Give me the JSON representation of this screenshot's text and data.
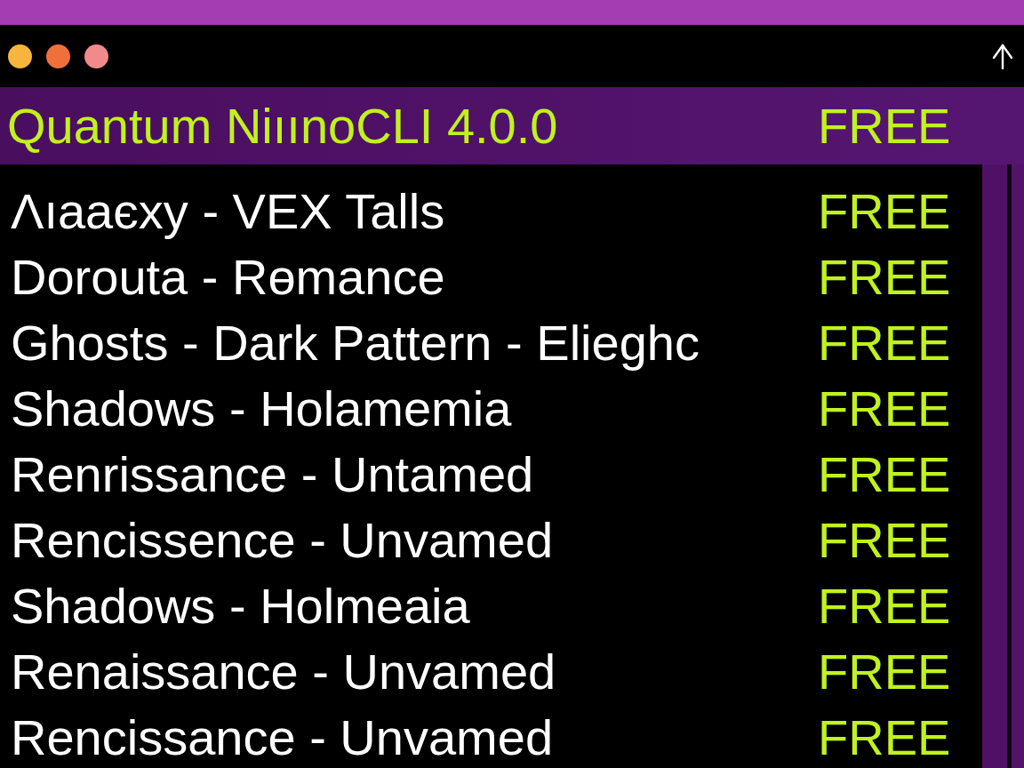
{
  "window": {
    "controls": [
      {
        "color": "#f7b43f"
      },
      {
        "color": "#f0703c"
      },
      {
        "color": "#f28a8c"
      }
    ]
  },
  "header": {
    "title": "Quantum NiıınoCLI 4.0.0",
    "price": "FREE"
  },
  "rows": [
    {
      "name": "Λıaaєxy - VEX Talls",
      "price": "FREE"
    },
    {
      "name": "Dorouta - Rөmance",
      "price": "FREE"
    },
    {
      "name": "Ghosts - Dark Pattern - Elieghc",
      "price": "FREE"
    },
    {
      "name": "Shadows - Holamemia",
      "price": "FREE"
    },
    {
      "name": "Renrissance - Untamed",
      "price": "FREE"
    },
    {
      "name": "Rencissence - Unvamed",
      "price": "FREE"
    },
    {
      "name": "Shadows - Holmeaia",
      "price": "FREE"
    },
    {
      "name": "Renaissance - Unvamed",
      "price": "FREE"
    },
    {
      "name": "Rencissance - Unvamed",
      "price": "FREE"
    }
  ]
}
